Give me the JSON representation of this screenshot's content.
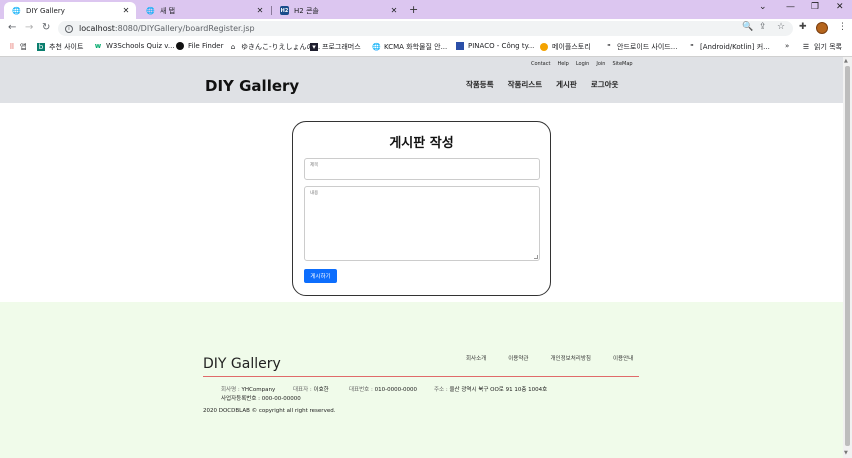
{
  "browser": {
    "tabs": [
      {
        "title": "DIY Gallery",
        "favicon": "globe-icon"
      },
      {
        "title": "새 탭",
        "favicon": "globe-icon"
      },
      {
        "title": "H2 콘솔",
        "favicon": "h2-icon"
      }
    ],
    "url_host": "localhost",
    "url_path": ":8080/DIYGallery/boardRegister.jsp",
    "bookmarks": [
      {
        "label": "앱",
        "icon": "apps-grid-icon"
      },
      {
        "label": "추천 사이트",
        "icon": "bing-icon"
      },
      {
        "label": "W3Schools Quiz v...",
        "icon": "w3schools-icon"
      },
      {
        "label": "File Finder",
        "icon": "github-icon"
      },
      {
        "label": "ゆきんこ-りえしょんの...",
        "icon": "blog-icon"
      },
      {
        "label": "프로그래머스",
        "icon": "programmers-icon"
      },
      {
        "label": "KCMA 화학물질 안...",
        "icon": "globe-icon"
      },
      {
        "label": "PINACO - Công ty...",
        "icon": "pinaco-icon"
      },
      {
        "label": "메이플스토리",
        "icon": "maple-icon"
      },
      {
        "label": "안드로이드 사이드...",
        "icon": "tistory-icon"
      },
      {
        "label": "[Android/Kotlin] 커...",
        "icon": "tistory-icon"
      }
    ],
    "reading_list": "읽기 목록"
  },
  "header": {
    "top_links": [
      "Contact",
      "Help",
      "Login",
      "Join",
      "SiteMap"
    ],
    "brand": "DIY Gallery",
    "nav": [
      "작품등록",
      "작품리스트",
      "게시판",
      "로그아웃"
    ]
  },
  "form": {
    "title": "게시판 작성",
    "title_label": "제목",
    "content_label": "내용",
    "submit": "게시하기"
  },
  "footer": {
    "brand": "DIY Gallery",
    "nav": [
      "회사소개",
      "이용약관",
      "개인정보처리방침",
      "이용안내"
    ],
    "company_key": "회사명 :",
    "company": "YHCompany",
    "ceo_key": "대표자 :",
    "ceo": "이효한",
    "phone_key": "대표번호 :",
    "phone": "010-0000-0000",
    "address_key": "주소 :",
    "address": "울산 광역시 북구 OO로 91 10층 1004호",
    "biz_no": "사업자등록번호 : 000-00-00000",
    "copyright": "2020 DOCDBLAB © copyright all right reserved."
  }
}
